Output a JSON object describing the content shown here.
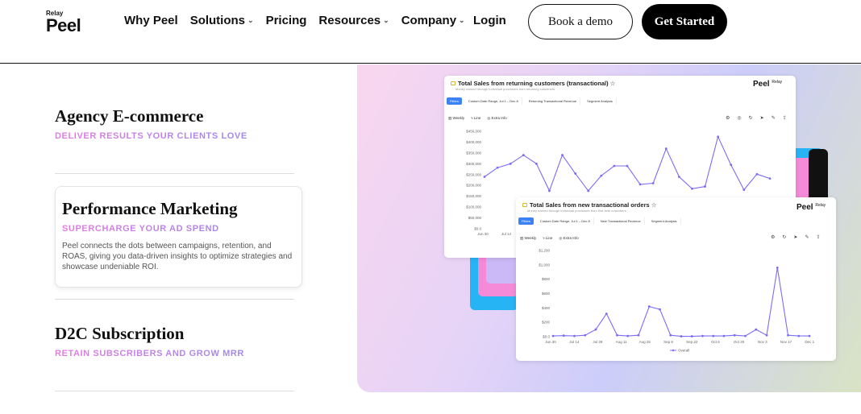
{
  "nav": {
    "logo_relay": "Relay",
    "logo_peel": "Peel",
    "items": [
      {
        "label": "Why Peel",
        "dropdown": false
      },
      {
        "label": "Solutions",
        "dropdown": true
      },
      {
        "label": "Pricing",
        "dropdown": false
      },
      {
        "label": "Resources",
        "dropdown": true
      },
      {
        "label": "Company",
        "dropdown": true
      }
    ],
    "login": "Login",
    "book_demo": "Book a demo",
    "get_started": "Get Started"
  },
  "features": [
    {
      "title": "Agency E-commerce",
      "subtitle": "DELIVER RESULTS YOUR CLIENTS LOVE"
    },
    {
      "title": "Performance Marketing",
      "subtitle": "SUPERCHARGE YOUR AD SPEND",
      "description": "Peel connects the dots between campaigns, retention, and ROAS, giving you data-driven insights to optimize strategies and showcase undeniable ROI."
    },
    {
      "title": "D2C Subscription",
      "subtitle": "RETAIN SUBSCRIBERS AND GROW MRR"
    }
  ],
  "colors": {
    "accent_pink": "#e47be0",
    "accent_purple": "#8a8cf0",
    "line": "#7b6cf6",
    "deco_blue": "#27b4f5",
    "deco_pink": "#f58ad9"
  },
  "chart1": {
    "title": "Total Sales from returning customers (transactional)",
    "subtitle": "Money earned through individual purchases from returning customers",
    "brand": "Peel",
    "brand_small": "Relay",
    "filters": [
      "Filters",
      "Custom Date Range, Jul 1 – Dec 8",
      "Returning Transactional Revenue",
      "Segment Analysis"
    ],
    "tools": [
      "Weekly",
      "Line",
      "Extra Info"
    ]
  },
  "chart2": {
    "title": "Total Sales from new transactional orders",
    "subtitle": "Money earned through individual purchases from first-time customers",
    "brand": "Peel",
    "brand_small": "Relay",
    "filters": [
      "Filters",
      "Custom Date Range, Jul 1 – Dec 8",
      "New Transactional Revenue",
      "Segment Analysis"
    ],
    "tools": [
      "Weekly",
      "Line",
      "Extra Info"
    ],
    "legend": "Overall"
  },
  "chart_data": [
    {
      "type": "line",
      "title": "Total Sales from returning customers (transactional)",
      "yticks": [
        "$450,000",
        "$400,000",
        "$350,000",
        "$300,000",
        "$250,000",
        "$200,000",
        "$150,000",
        "$100,000",
        "$50,000",
        "$0.0"
      ],
      "ylim": [
        0,
        450000
      ],
      "xticks": [
        "Jun 30",
        "Jul 14"
      ],
      "series": [
        {
          "values": [
            240000,
            282000,
            300000,
            340000,
            300000,
            175000,
            340000,
            255000,
            175000,
            245000,
            290000,
            290000,
            205000,
            210000,
            370000,
            240000,
            185000,
            195000,
            425000,
            295000,
            180000,
            252000,
            232000
          ]
        }
      ]
    },
    {
      "type": "line",
      "title": "Total Sales from new transactional orders",
      "yticks": [
        "$1,200",
        "$1,000",
        "$800",
        "$600",
        "$400",
        "$200",
        "$0.0"
      ],
      "ylim": [
        0,
        1200
      ],
      "xticks": [
        "Jun 30",
        "Jul 14",
        "Jul 28",
        "Aug 11",
        "Aug 25",
        "Sep 8",
        "Sep 22",
        "Oct 6",
        "Oct 20",
        "Nov 3",
        "Nov 17",
        "Dec 1"
      ],
      "series": [
        {
          "name": "Overall",
          "values": [
            10,
            15,
            10,
            20,
            100,
            320,
            20,
            10,
            20,
            420,
            380,
            20,
            5,
            5,
            10,
            10,
            10,
            20,
            10,
            100,
            20,
            960,
            20,
            10,
            10
          ]
        }
      ]
    }
  ]
}
